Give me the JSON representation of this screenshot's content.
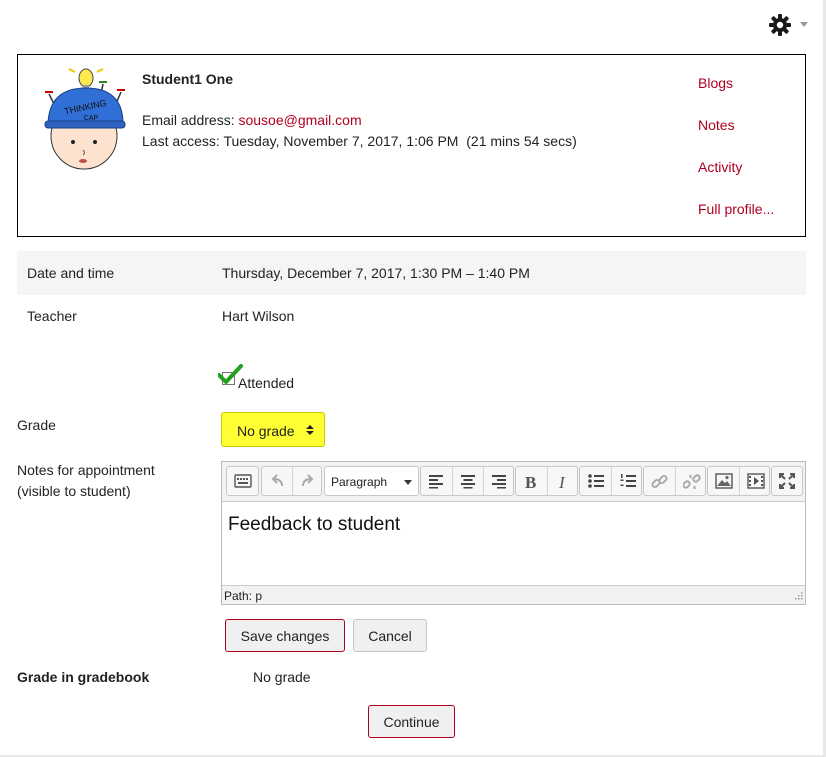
{
  "header": {
    "settings_icon": "gear-icon"
  },
  "profile": {
    "name": "Student1 One",
    "email_label": "Email address: ",
    "email": "sousoe@gmail.com",
    "last_access": "Last access: Tuesday, November 7, 2017, 1:06 PM  (21 mins 54 secs)",
    "avatar_caption_top": "THINKING",
    "avatar_caption_bottom": "CAP",
    "links": [
      "Blogs",
      "Notes",
      "Activity",
      "Full profile..."
    ]
  },
  "appointment": {
    "date_label": "Date and time",
    "date_value": "Thursday, December 7, 2017, 1:30 PM – 1:40 PM",
    "teacher_label": "Teacher",
    "teacher_value": "Hart Wilson",
    "attended_label": "Attended",
    "attended_checked": true
  },
  "form": {
    "grade_label": "Grade",
    "grade_value": "No grade",
    "notes_label_line1": "Notes for appointment",
    "notes_label_line2": "(visible to student)",
    "editor": {
      "paragraph_format": "Paragraph",
      "content": "Feedback to student",
      "path": "Path: p",
      "toolbar_icons": [
        "keyboard-icon",
        "undo-icon",
        "redo-icon",
        "align-left-icon",
        "align-center-icon",
        "align-right-icon",
        "bold-icon",
        "italic-icon",
        "bullet-list-icon",
        "numbered-list-icon",
        "link-icon",
        "unlink-icon",
        "image-icon",
        "media-icon",
        "fullscreen-icon"
      ]
    },
    "save_label": "Save changes",
    "cancel_label": "Cancel"
  },
  "gradebook": {
    "label": "Grade in gradebook",
    "value": "No grade"
  },
  "continue_label": "Continue",
  "colors": {
    "link": "#b00020",
    "highlight": "#ffff33",
    "check": "#22a020",
    "border": "#000000"
  }
}
